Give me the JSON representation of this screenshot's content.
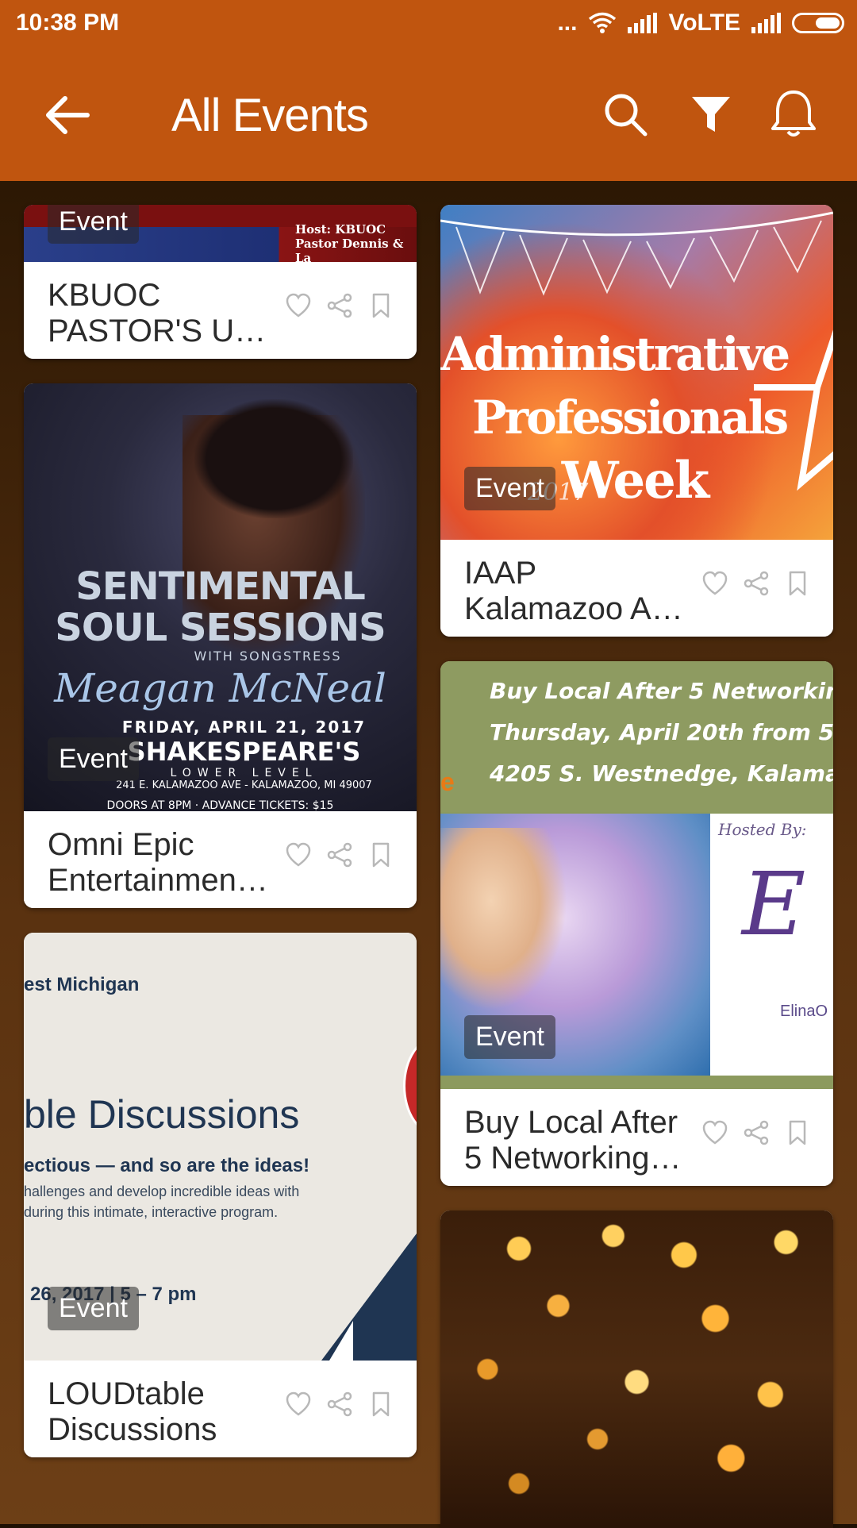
{
  "status_bar": {
    "time": "10:38 PM",
    "dots": "...",
    "network": "VoLTE"
  },
  "app_bar": {
    "title": "All Events",
    "back_icon": "arrow-left-icon",
    "search_icon": "search-icon",
    "filter_icon": "filter-icon",
    "notification_icon": "bell-icon"
  },
  "badge_label": "Event",
  "events": [
    {
      "name": "KBUOC PASTOR'S U…",
      "poster_text": [
        "Host: KBUOC",
        "Pastor Dennis & La"
      ]
    },
    {
      "name": "IAAP Kalamazoo A…",
      "poster_text": [
        "Administrative",
        "Professionals",
        "Week",
        "2017"
      ]
    },
    {
      "name": "Omni Epic Entertainmen…",
      "poster_text": [
        "SENTIMENTAL",
        "SOUL SESSIONS",
        "WITH SONGSTRESS",
        "Meagan McNeal",
        "FRIDAY, APRIL 21, 2017",
        "SHAKESPEARE'S",
        "LOWER LEVEL",
        "241 E. KALAMAZOO AVE - KALAMAZOO, MI 49007",
        "DOORS AT 8PM · ADVANCE TICKETS: $15"
      ]
    },
    {
      "name": "Buy Local After 5 Networking…",
      "poster_text": [
        "Buy Local After 5 Networkin",
        "Thursday, April 20th from 5-",
        "4205 S. Westnedge, Kalama",
        "Hosted By:",
        "ElinaO"
      ]
    },
    {
      "name": "LOUDtable Discussions",
      "poster_text": [
        "est Michigan",
        "ble Discussions",
        "ectious — and so are the ideas!",
        "hallenges and develop incredible ideas with",
        "during this intimate, interactive program.",
        "26, 2017 | 5 – 7 pm"
      ]
    }
  ],
  "colors": {
    "primary": "#c0550f",
    "card_bg": "#ffffff",
    "text": "#2b2b2b",
    "icon_gray": "#b8b8b8"
  }
}
